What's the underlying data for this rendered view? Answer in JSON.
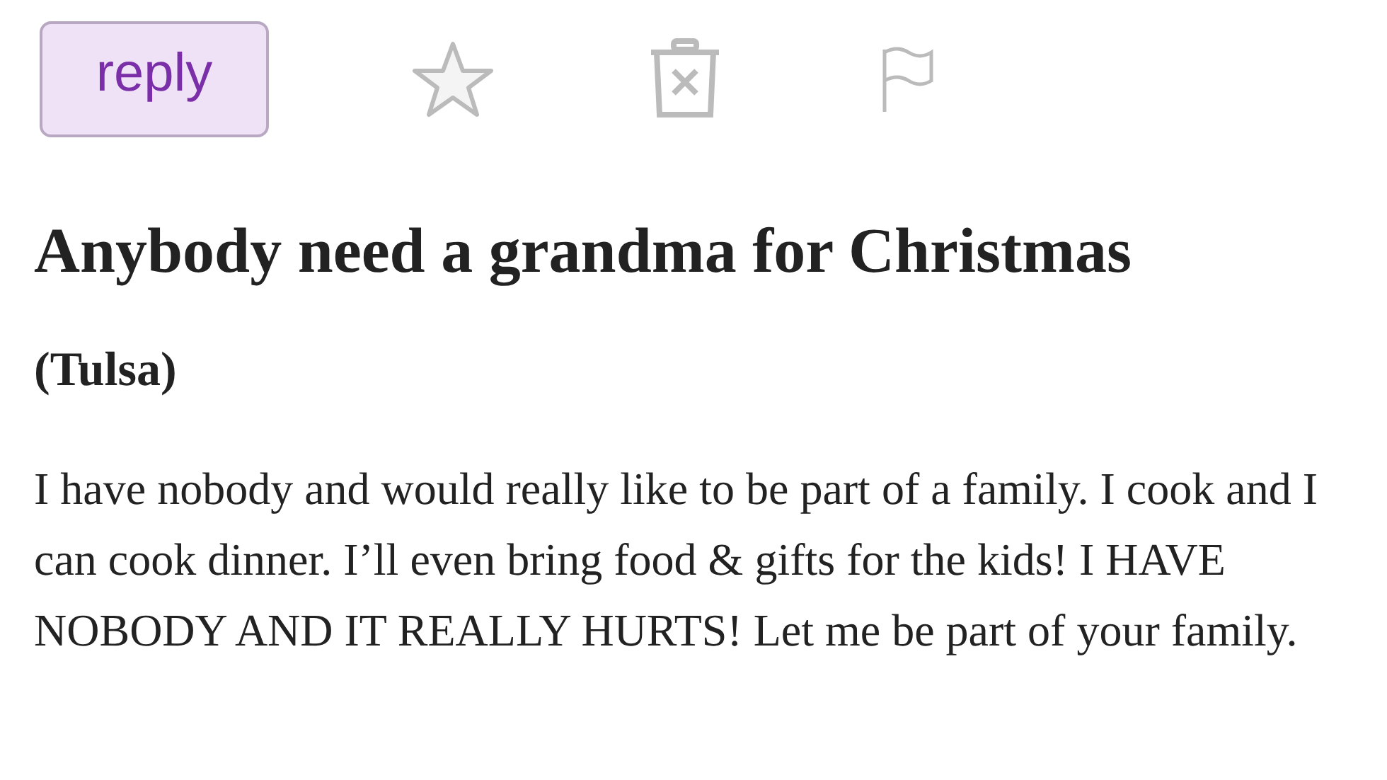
{
  "toolbar": {
    "reply_button": "reply"
  },
  "posting": {
    "title": "Anybody need a grandma for Christmas",
    "location": "(Tulsa)",
    "body": "I have nobody and would really like to be part of a family. I cook and I can cook dinner. I’ll even bring food & gifts for the kids! I HAVE NOBODY AND IT REALLY HURTS! Let me be part of your family."
  }
}
